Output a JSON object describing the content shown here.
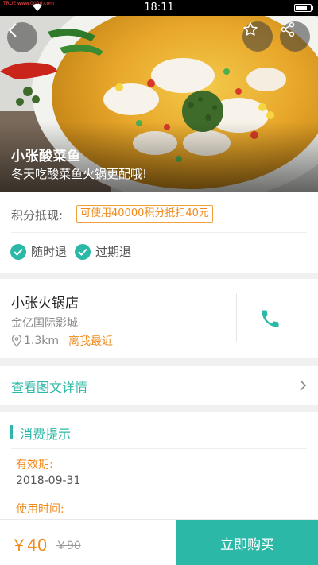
{
  "status_bar": {
    "carrier": "TRUE www.0000.com",
    "time": "18:11"
  },
  "hero": {
    "title": "小张酸菜鱼",
    "subtitle": "冬天吃酸菜鱼火锅更配哦!",
    "icons": {
      "back": "back-arrow-icon",
      "favorite": "star-icon",
      "share": "share-icon"
    }
  },
  "points": {
    "label": "积分抵现:",
    "badge": "可使用40000积分抵扣40元"
  },
  "refund": {
    "anytime": "随时退",
    "expired": "过期退"
  },
  "shop": {
    "name": "小张火锅店",
    "mall": "金亿国际影城",
    "distance": "1.3km",
    "nearest": "离我最近"
  },
  "details": {
    "link": "查看图文详情"
  },
  "tips": {
    "title": "消费提示",
    "valid_label": "有效期:",
    "valid_value": "2018-09-31",
    "time_label": "使用时间:"
  },
  "bottom": {
    "price": "￥40",
    "original_price": "￥90",
    "buy_label": "立即购买"
  },
  "colors": {
    "accent": "#2bb8a6",
    "orange": "#f08a1c",
    "background": "#f0f0f0"
  }
}
